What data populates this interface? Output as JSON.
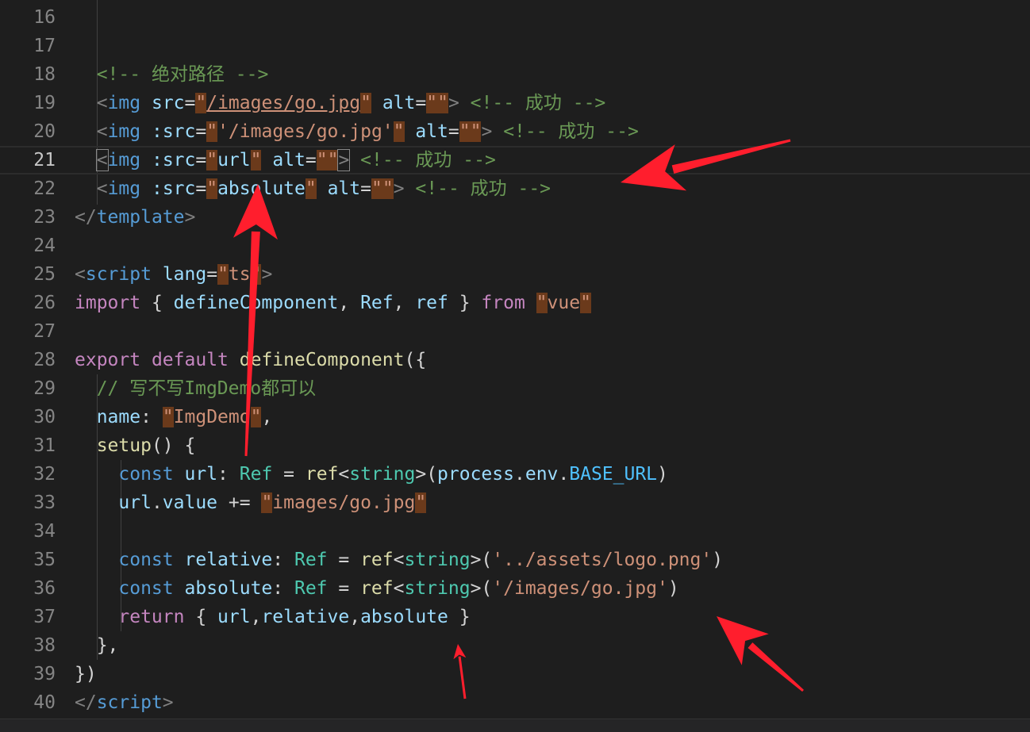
{
  "editor": {
    "lines": [
      {
        "n": "16",
        "tokens": []
      },
      {
        "n": "17",
        "tokens": []
      },
      {
        "n": "18",
        "tokens": [
          [
            "t-p",
            "  "
          ],
          [
            "t-cm",
            "<!-- 绝对路径 -->"
          ]
        ]
      },
      {
        "n": "19",
        "tokens": [
          [
            "t-p",
            "  "
          ],
          [
            "t-br",
            "<"
          ],
          [
            "t-tag",
            "img"
          ],
          [
            "t-p",
            " "
          ],
          [
            "t-attr",
            "src"
          ],
          [
            "t-p",
            "="
          ],
          [
            "t-q",
            "\""
          ],
          [
            "t-str u",
            "/images/go.jpg"
          ],
          [
            "t-q",
            "\""
          ],
          [
            "t-p",
            " "
          ],
          [
            "t-attr",
            "alt"
          ],
          [
            "t-p",
            "="
          ],
          [
            "t-q",
            "\"\""
          ],
          [
            "t-br",
            ">"
          ],
          [
            "t-p",
            " "
          ],
          [
            "t-cm",
            "<!-- 成功 -->"
          ]
        ]
      },
      {
        "n": "20",
        "tokens": [
          [
            "t-p",
            "  "
          ],
          [
            "t-br",
            "<"
          ],
          [
            "t-tag",
            "img"
          ],
          [
            "t-p",
            " "
          ],
          [
            "t-attr",
            ":src"
          ],
          [
            "t-p",
            "="
          ],
          [
            "t-q",
            "\""
          ],
          [
            "t-str",
            "'/images/go.jpg'"
          ],
          [
            "t-q",
            "\""
          ],
          [
            "t-p",
            " "
          ],
          [
            "t-attr",
            "alt"
          ],
          [
            "t-p",
            "="
          ],
          [
            "t-q",
            "\"\""
          ],
          [
            "t-br",
            ">"
          ],
          [
            "t-p",
            " "
          ],
          [
            "t-cm",
            "<!-- 成功 -->"
          ]
        ]
      },
      {
        "n": "21",
        "tokens": [
          [
            "t-p",
            "  "
          ],
          [
            "t-br bm",
            "<"
          ],
          [
            "t-tag",
            "img"
          ],
          [
            "t-p",
            " "
          ],
          [
            "t-attr",
            ":src"
          ],
          [
            "t-p",
            "="
          ],
          [
            "t-q",
            "\""
          ],
          [
            "t-var",
            "url"
          ],
          [
            "t-q",
            "\""
          ],
          [
            "t-p",
            " "
          ],
          [
            "t-attr",
            "alt"
          ],
          [
            "t-p",
            "="
          ],
          [
            "t-q",
            "\"\""
          ],
          [
            "t-br bm",
            ">"
          ],
          [
            "t-p",
            " "
          ],
          [
            "t-cm",
            "<!-- 成功 -->"
          ]
        ]
      },
      {
        "n": "22",
        "tokens": [
          [
            "t-p",
            "  "
          ],
          [
            "t-br",
            "<"
          ],
          [
            "t-tag",
            "img"
          ],
          [
            "t-p",
            " "
          ],
          [
            "t-attr",
            ":src"
          ],
          [
            "t-p",
            "="
          ],
          [
            "t-q",
            "\""
          ],
          [
            "t-var",
            "absolute"
          ],
          [
            "t-q",
            "\""
          ],
          [
            "t-p",
            " "
          ],
          [
            "t-attr",
            "alt"
          ],
          [
            "t-p",
            "="
          ],
          [
            "t-q",
            "\"\""
          ],
          [
            "t-br",
            ">"
          ],
          [
            "t-p",
            " "
          ],
          [
            "t-cm",
            "<!-- 成功 -->"
          ]
        ]
      },
      {
        "n": "23",
        "tokens": [
          [
            "t-br",
            "</"
          ],
          [
            "t-tag",
            "template"
          ],
          [
            "t-br",
            ">"
          ]
        ]
      },
      {
        "n": "24",
        "tokens": []
      },
      {
        "n": "25",
        "tokens": [
          [
            "t-br",
            "<"
          ],
          [
            "t-tag",
            "script"
          ],
          [
            "t-p",
            " "
          ],
          [
            "t-attr",
            "lang"
          ],
          [
            "t-p",
            "="
          ],
          [
            "t-q",
            "\""
          ],
          [
            "t-str",
            "ts"
          ],
          [
            "t-q",
            "\""
          ],
          [
            "t-br",
            ">"
          ]
        ]
      },
      {
        "n": "26",
        "tokens": [
          [
            "t-kw",
            "import"
          ],
          [
            "t-p",
            " { "
          ],
          [
            "t-var",
            "defineComponent"
          ],
          [
            "t-p",
            ", "
          ],
          [
            "t-var",
            "Ref"
          ],
          [
            "t-p",
            ", "
          ],
          [
            "t-var",
            "ref"
          ],
          [
            "t-p",
            " } "
          ],
          [
            "t-kw",
            "from"
          ],
          [
            "t-p",
            " "
          ],
          [
            "t-q",
            "\""
          ],
          [
            "t-str",
            "vue"
          ],
          [
            "t-q",
            "\""
          ]
        ]
      },
      {
        "n": "27",
        "tokens": []
      },
      {
        "n": "28",
        "tokens": [
          [
            "t-kw",
            "export"
          ],
          [
            "t-p",
            " "
          ],
          [
            "t-kw",
            "default"
          ],
          [
            "t-p",
            " "
          ],
          [
            "t-fn",
            "defineComponent"
          ],
          [
            "t-p",
            "({"
          ]
        ]
      },
      {
        "n": "29",
        "tokens": [
          [
            "t-p",
            "  "
          ],
          [
            "t-cm",
            "// 写不写ImgDemo都可以"
          ]
        ]
      },
      {
        "n": "30",
        "tokens": [
          [
            "t-p",
            "  "
          ],
          [
            "t-var",
            "name"
          ],
          [
            "t-p",
            ": "
          ],
          [
            "t-q",
            "\""
          ],
          [
            "t-str",
            "ImgDemo"
          ],
          [
            "t-q",
            "\""
          ],
          [
            "t-p",
            ","
          ]
        ]
      },
      {
        "n": "31",
        "tokens": [
          [
            "t-p",
            "  "
          ],
          [
            "t-fn",
            "setup"
          ],
          [
            "t-p",
            "() {"
          ]
        ]
      },
      {
        "n": "32",
        "tokens": [
          [
            "t-p",
            "    "
          ],
          [
            "t-st",
            "const"
          ],
          [
            "t-p",
            " "
          ],
          [
            "t-var",
            "url"
          ],
          [
            "t-p",
            ": "
          ],
          [
            "t-ty",
            "Ref"
          ],
          [
            "t-p",
            " = "
          ],
          [
            "t-fn",
            "ref"
          ],
          [
            "t-p",
            "<"
          ],
          [
            "t-ty",
            "string"
          ],
          [
            "t-p",
            ">("
          ],
          [
            "t-var",
            "process"
          ],
          [
            "t-p",
            "."
          ],
          [
            "t-var",
            "env"
          ],
          [
            "t-p",
            "."
          ],
          [
            "t-const",
            "BASE_URL"
          ],
          [
            "t-p",
            ")"
          ]
        ]
      },
      {
        "n": "33",
        "tokens": [
          [
            "t-p",
            "    "
          ],
          [
            "t-var",
            "url"
          ],
          [
            "t-p",
            "."
          ],
          [
            "t-var",
            "value"
          ],
          [
            "t-p",
            " += "
          ],
          [
            "t-q",
            "\""
          ],
          [
            "t-str",
            "images/go.jpg"
          ],
          [
            "t-q",
            "\""
          ]
        ]
      },
      {
        "n": "34",
        "tokens": []
      },
      {
        "n": "35",
        "tokens": [
          [
            "t-p",
            "    "
          ],
          [
            "t-st",
            "const"
          ],
          [
            "t-p",
            " "
          ],
          [
            "t-var",
            "relative"
          ],
          [
            "t-p",
            ": "
          ],
          [
            "t-ty",
            "Ref"
          ],
          [
            "t-p",
            " = "
          ],
          [
            "t-fn",
            "ref"
          ],
          [
            "t-p",
            "<"
          ],
          [
            "t-ty",
            "string"
          ],
          [
            "t-p",
            ">("
          ],
          [
            "t-str",
            "'../assets/logo.png'"
          ],
          [
            "t-p",
            ")"
          ]
        ]
      },
      {
        "n": "36",
        "tokens": [
          [
            "t-p",
            "    "
          ],
          [
            "t-st",
            "const"
          ],
          [
            "t-p",
            " "
          ],
          [
            "t-var",
            "absolute"
          ],
          [
            "t-p",
            ": "
          ],
          [
            "t-ty",
            "Ref"
          ],
          [
            "t-p",
            " = "
          ],
          [
            "t-fn",
            "ref"
          ],
          [
            "t-p",
            "<"
          ],
          [
            "t-ty",
            "string"
          ],
          [
            "t-p",
            ">("
          ],
          [
            "t-str",
            "'/images/go.jpg'"
          ],
          [
            "t-p",
            ")"
          ]
        ]
      },
      {
        "n": "37",
        "tokens": [
          [
            "t-p",
            "    "
          ],
          [
            "t-kw",
            "return"
          ],
          [
            "t-p",
            " { "
          ],
          [
            "t-var",
            "url"
          ],
          [
            "t-p",
            ","
          ],
          [
            "t-var",
            "relative"
          ],
          [
            "t-p",
            ","
          ],
          [
            "t-var",
            "absolute"
          ],
          [
            "t-p",
            " }"
          ]
        ]
      },
      {
        "n": "38",
        "tokens": [
          [
            "t-p",
            "  },"
          ]
        ]
      },
      {
        "n": "39",
        "tokens": [
          [
            "t-p",
            "})"
          ]
        ]
      },
      {
        "n": "40",
        "tokens": [
          [
            "t-br",
            "</"
          ],
          [
            "t-tag",
            "script"
          ],
          [
            "t-br",
            ">"
          ]
        ]
      }
    ],
    "current_line": "21"
  },
  "annotations": {
    "color": "#ff1e2d",
    "arrows": [
      "arrow-to-line-21",
      "arrow-to-absolute-binding",
      "arrow-to-return-object",
      "arrow-small-pointer"
    ]
  }
}
